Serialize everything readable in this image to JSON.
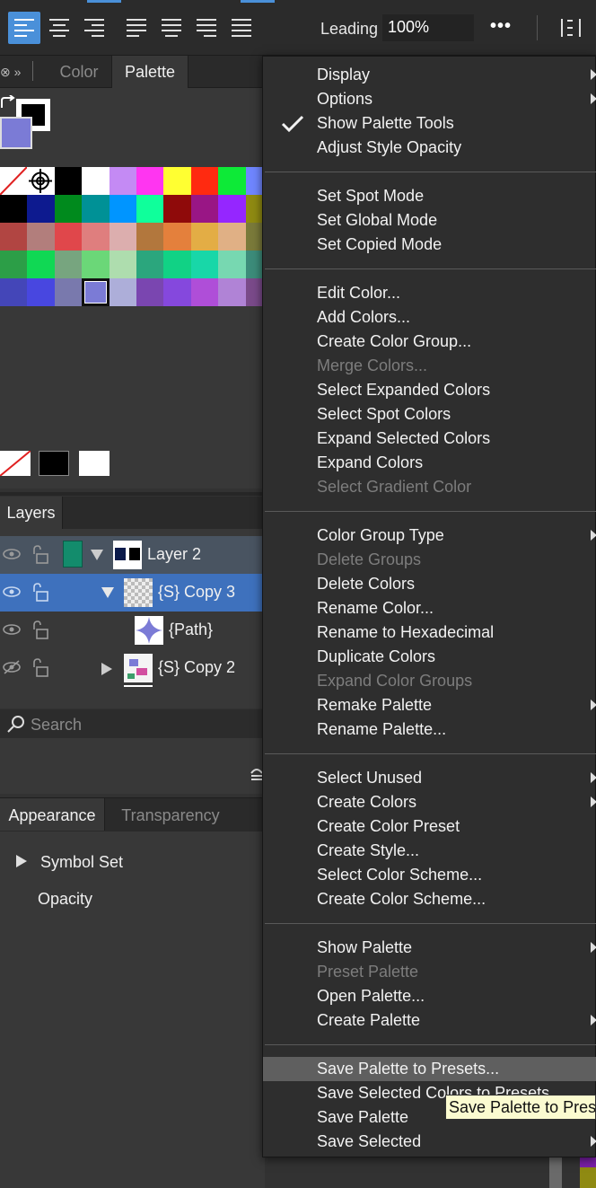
{
  "toolbar": {
    "leading_label": "Leading",
    "leading_value": "100%",
    "more_label": "•••"
  },
  "palette_panel": {
    "tabs": [
      "Color",
      "Palette"
    ],
    "active_tab": "Palette",
    "fill_color": "#7b7bd6",
    "swatches": [
      [
        "none",
        "target",
        "#000000",
        "#ffffff",
        "#c48af4",
        "#ff35f1",
        "#ffff32",
        "#ff2a10",
        "#0dea37",
        "#6f86ff"
      ],
      [
        "#000000",
        "#0d1a8f",
        "#008a1d",
        "#009196",
        "#0095ff",
        "#0fff9b",
        "#8f0a0a",
        "#991685",
        "#9526ff",
        "#8f8a12"
      ],
      [
        "#b14542",
        "#b27e7c",
        "#e0474b",
        "#df7e7e",
        "#dcaeae",
        "#b2773d",
        "#e4803c",
        "#e3ad45",
        "#e0b085",
        "#7a7a3a"
      ],
      [
        "#2c9e47",
        "#10d854",
        "#77a57f",
        "#6bd778",
        "#aeddae",
        "#2ba67d",
        "#11d285",
        "#18d7a8",
        "#77d8b1",
        "#3c8c7a"
      ],
      [
        "#4446b8",
        "#4847e0",
        "#7979ad",
        "#7b7bd6",
        "#adaed9",
        "#7a46b0",
        "#8548dd",
        "#af4ed8",
        "#b083d6",
        "#7a4a8a"
      ]
    ],
    "selected_swatch": "#7b7bd6",
    "quick_swatches": [
      "none",
      "#000000",
      "#ffffff"
    ]
  },
  "layers_panel": {
    "tab": "Layers",
    "rows": [
      {
        "name": "Layer 2"
      },
      {
        "name": "{S} Copy 3"
      },
      {
        "name": "{Path}"
      },
      {
        "name": "{S} Copy 2"
      }
    ],
    "search_placeholder": "Search"
  },
  "appearance_panel": {
    "tabs": [
      "Appearance",
      "Transparency"
    ],
    "items": [
      "Symbol Set",
      "Opacity"
    ]
  },
  "menu": {
    "groups": [
      [
        {
          "label": "Display",
          "submenu": true
        },
        {
          "label": "Options",
          "submenu": true
        },
        {
          "label": "Show Palette Tools",
          "checked": true
        },
        {
          "label": "Adjust Style Opacity"
        }
      ],
      [
        {
          "label": "Set Spot Mode"
        },
        {
          "label": "Set Global Mode"
        },
        {
          "label": "Set Copied Mode"
        }
      ],
      [
        {
          "label": "Edit Color..."
        },
        {
          "label": "Add Colors..."
        },
        {
          "label": "Create Color Group..."
        },
        {
          "label": "Merge Colors...",
          "disabled": true
        },
        {
          "label": "Select Expanded Colors"
        },
        {
          "label": "Select Spot Colors"
        },
        {
          "label": "Expand Selected Colors"
        },
        {
          "label": "Expand Colors"
        },
        {
          "label": "Select Gradient Color",
          "disabled": true
        }
      ],
      [
        {
          "label": "Color Group Type",
          "submenu": true
        },
        {
          "label": "Delete Groups",
          "disabled": true
        },
        {
          "label": "Delete Colors"
        },
        {
          "label": "Rename Color..."
        },
        {
          "label": "Rename to Hexadecimal"
        },
        {
          "label": "Duplicate Colors"
        },
        {
          "label": "Expand Color Groups",
          "disabled": true
        },
        {
          "label": "Remake Palette",
          "submenu": true
        },
        {
          "label": "Rename Palette..."
        }
      ],
      [
        {
          "label": "Select Unused",
          "submenu": true
        },
        {
          "label": "Create Colors",
          "submenu": true
        },
        {
          "label": "Create Color Preset"
        },
        {
          "label": "Create Style..."
        },
        {
          "label": "Select Color Scheme..."
        },
        {
          "label": "Create Color Scheme..."
        }
      ],
      [
        {
          "label": "Show Palette",
          "submenu": true
        },
        {
          "label": "Preset Palette",
          "disabled": true
        },
        {
          "label": "Open Palette..."
        },
        {
          "label": "Create Palette",
          "submenu": true
        }
      ],
      [
        {
          "label": "Save Palette to Presets...",
          "highlight": true
        },
        {
          "label": "Save Selected Colors to Presets..."
        },
        {
          "label": "Save Palette"
        },
        {
          "label": "Save Selected",
          "submenu": true
        }
      ]
    ]
  },
  "tooltip": "Save Palette to Presets"
}
